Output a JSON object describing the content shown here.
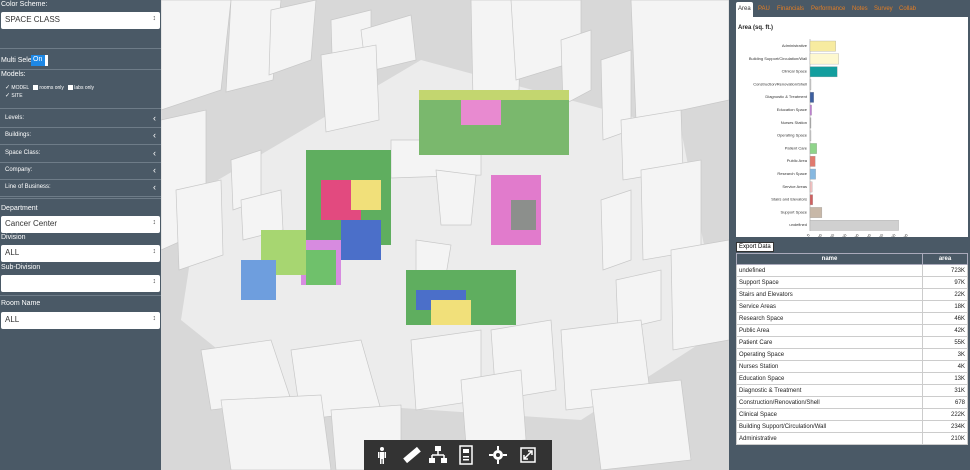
{
  "sidebar": {
    "color_scheme_label": "Color Scheme:",
    "color_scheme_value": "SPACE CLASS",
    "multi_select_label": "Multi Select:",
    "multi_select_state": "On",
    "models_label": "Models:",
    "model_options": [
      {
        "label": "MODEL",
        "checked": true
      },
      {
        "label": "rooms only",
        "checked": false
      },
      {
        "label": "labs only",
        "checked": false
      }
    ],
    "site_option": {
      "label": "SITE",
      "checked": true
    },
    "accordions": [
      "Levels:",
      "Buildings:",
      "Space Class:",
      "Company:",
      "Line of Business:"
    ],
    "department_label": "Department",
    "department_value": "Cancer Center",
    "division_label": "Division",
    "division_value": "ALL",
    "subdivision_label": "Sub-Division",
    "subdivision_value": "",
    "room_name_label": "Room Name",
    "room_name_value": "ALL"
  },
  "tabs": [
    {
      "label": "Area",
      "active": true
    },
    {
      "label": "PAU",
      "active": false
    },
    {
      "label": "Financials",
      "active": false
    },
    {
      "label": "Performance",
      "active": false
    },
    {
      "label": "Notes",
      "active": false
    },
    {
      "label": "Survey",
      "active": false
    },
    {
      "label": "Collab",
      "active": false
    }
  ],
  "chart_data": {
    "type": "bar",
    "orientation": "horizontal",
    "title": "Area (sq. ft.)",
    "categories": [
      "Administrative",
      "Building Support/Circulation/Wall",
      "Clinical Space",
      "Construction/Renovation/Shell",
      "Diagnostic & Treatment",
      "Education Space",
      "Nurses Station",
      "Operating Space",
      "Patient Care",
      "Public Area",
      "Research Space",
      "Service Areas",
      "Stairs and Elevators",
      "Support Space",
      "undefined"
    ],
    "values": [
      210000,
      234000,
      222000,
      678,
      31000,
      13000,
      4000,
      3000,
      55000,
      42000,
      46000,
      18000,
      22000,
      97000,
      723000
    ],
    "colors": [
      "#f7eba0",
      "#fdf8d0",
      "#139e9e",
      "#cfcfcf",
      "#3d5fa0",
      "#c27bd8",
      "#aaaaaa",
      "#cccccc",
      "#8fd48a",
      "#e07a6e",
      "#86b8e0",
      "#f0c0c0",
      "#d06060",
      "#c8b8a8",
      "#d0d0d0"
    ],
    "xticks": [
      "0",
      "100,000",
      "200,000",
      "300,000",
      "400,000",
      "500,000",
      "600,000",
      "700,000",
      "800,000"
    ],
    "xlim": [
      0,
      800000
    ]
  },
  "export_label": "Export Data",
  "table": {
    "headers": [
      "name",
      "area"
    ],
    "rows": [
      [
        "undefined",
        "723K"
      ],
      [
        "Support Space",
        "97K"
      ],
      [
        "Stairs and Elevators",
        "22K"
      ],
      [
        "Service Areas",
        "18K"
      ],
      [
        "Research Space",
        "46K"
      ],
      [
        "Public Area",
        "42K"
      ],
      [
        "Patient Care",
        "55K"
      ],
      [
        "Operating Space",
        "3K"
      ],
      [
        "Nurses Station",
        "4K"
      ],
      [
        "Education Space",
        "13K"
      ],
      [
        "Diagnostic & Treatment",
        "31K"
      ],
      [
        "Construction/Renovation/Shell",
        "678"
      ],
      [
        "Clinical Space",
        "222K"
      ],
      [
        "Building Support/Circulation/Wall",
        "234K"
      ],
      [
        "Administrative",
        "210K"
      ]
    ]
  },
  "toolbar_icons": [
    "person-icon",
    "ruler-icon",
    "hierarchy-icon",
    "properties-icon",
    "gear-icon",
    "fullscreen-icon"
  ]
}
